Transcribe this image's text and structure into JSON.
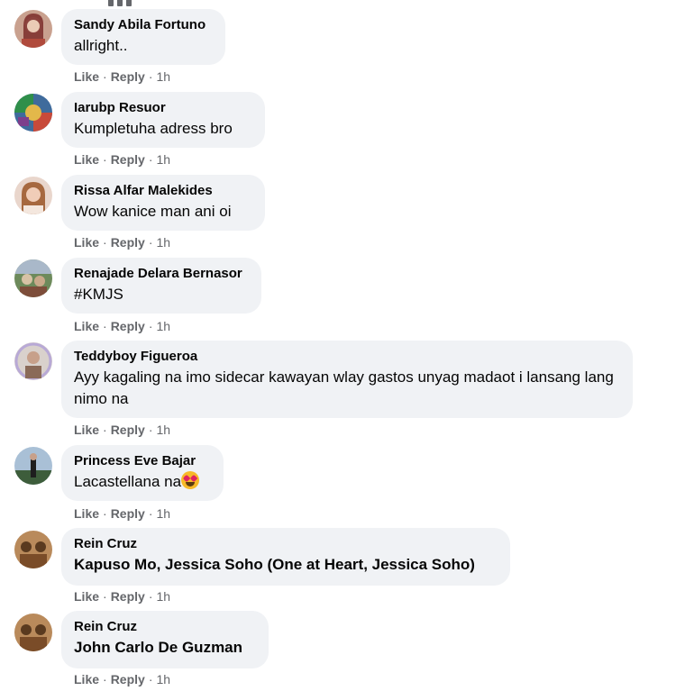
{
  "labels": {
    "like": "Like",
    "reply": "Reply",
    "dot": "·"
  },
  "comments": [
    {
      "author": "Sandy Abila Fortuno",
      "text": "allright..",
      "time": "1h",
      "bold": false,
      "avatar": {
        "bg": "#c9a18f",
        "fg": "#7b2d2a"
      }
    },
    {
      "author": "Iarubp Resuor",
      "text": "Kumpletuha adress bro",
      "time": "1h",
      "bold": false,
      "avatar": {
        "bg": "#3f6b9c",
        "fg": "#c84a3a"
      }
    },
    {
      "author": "Rissa Alfar Malekides",
      "text": "Wow kanice man ani oi",
      "time": "1h",
      "bold": false,
      "avatar": {
        "bg": "#e9d6cc",
        "fg": "#a6683f"
      }
    },
    {
      "author": "Renajade Delara Bernasor",
      "text": "#KMJS",
      "time": "1h",
      "bold": false,
      "avatar": {
        "bg": "#6d8a5b",
        "fg": "#d8c2a5"
      }
    },
    {
      "author": "Teddyboy Figueroa",
      "text": "Ayy kagaling na imo sidecar kawayan wlay gastos unyag madaot i lansang lang nimo na",
      "time": "1h",
      "bold": false,
      "avatar": {
        "bg": "#d9d1cc",
        "fg": "#8a6a58"
      }
    },
    {
      "author": "Princess Eve Bajar",
      "text": "Lacastellana na",
      "time": "1h",
      "bold": false,
      "emoji": "heart-eyes",
      "avatar": {
        "bg": "#a9c0d6",
        "fg": "#3d5d3b"
      }
    },
    {
      "author": "Rein Cruz",
      "text": "Kapuso Mo, Jessica Soho (One at Heart, Jessica Soho)",
      "time": "1h",
      "bold": true,
      "avatar": {
        "bg": "#b98a5b",
        "fg": "#7a4c28"
      }
    },
    {
      "author": "Rein Cruz",
      "text": "John Carlo De Guzman",
      "time": "1h",
      "bold": true,
      "avatar": {
        "bg": "#b98a5b",
        "fg": "#7a4c28"
      }
    }
  ]
}
